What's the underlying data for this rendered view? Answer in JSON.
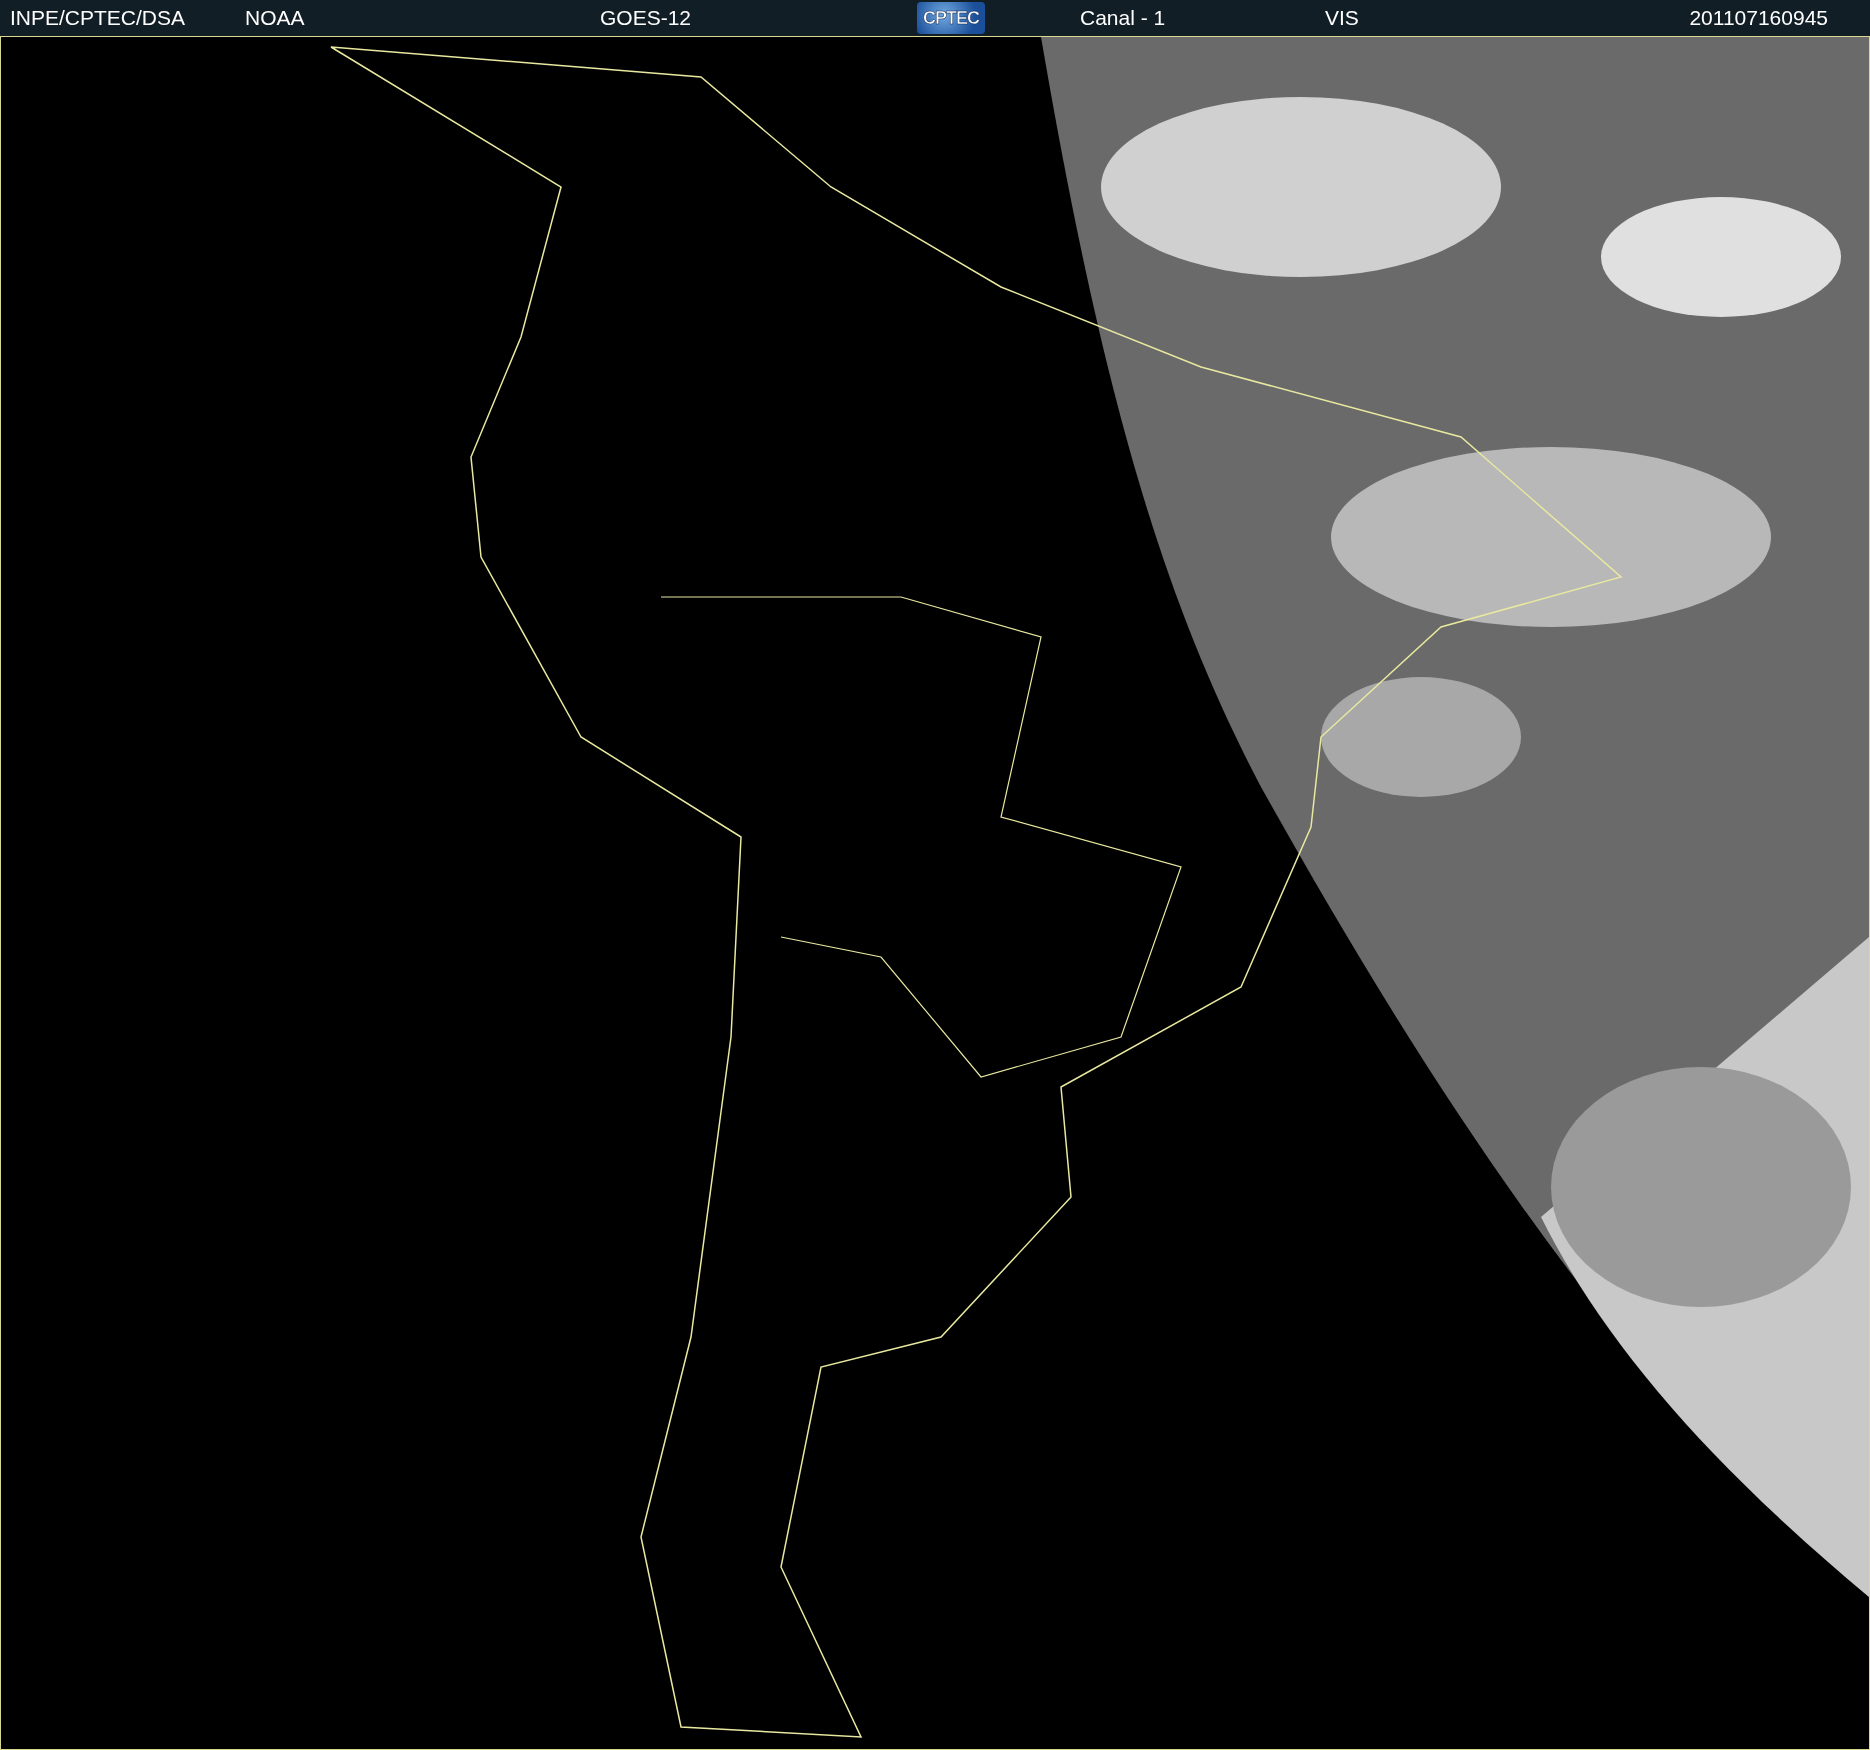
{
  "header": {
    "items": [
      {
        "kind": "label",
        "text": "INPE/CPTEC/DSA"
      },
      {
        "kind": "label",
        "text": "NOAA"
      },
      {
        "kind": "label",
        "text": "GOES-12"
      },
      {
        "kind": "logo",
        "text": "CPTEC"
      },
      {
        "kind": "label",
        "text": "Canal - 1"
      },
      {
        "kind": "label",
        "text": "VIS"
      },
      {
        "kind": "label",
        "text": "201107160945"
      }
    ]
  }
}
